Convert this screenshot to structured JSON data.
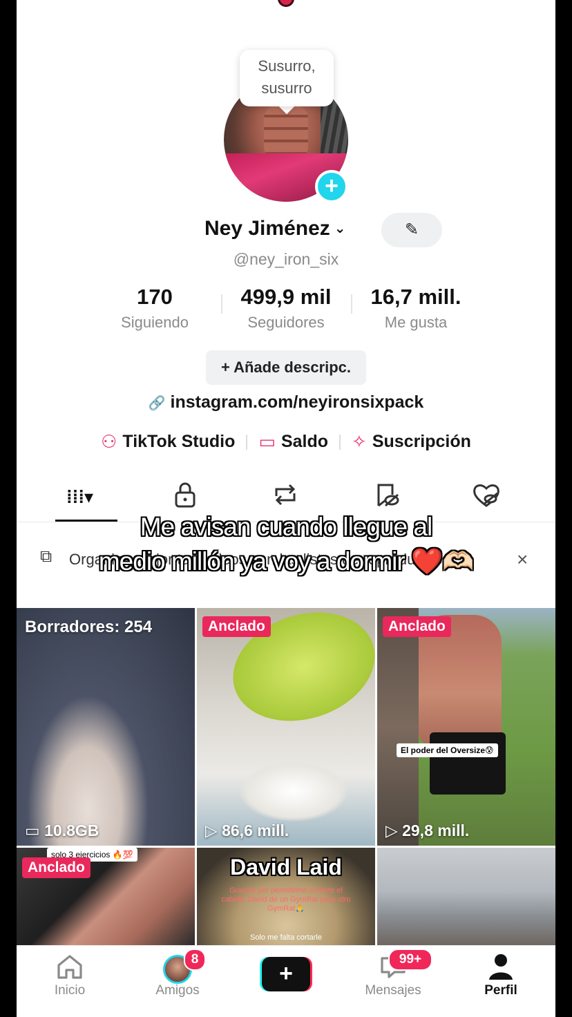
{
  "bubble": {
    "line1": "Susurro,",
    "line2": "susurro"
  },
  "profile": {
    "name": "Ney Jiménez",
    "chevron": "⌄",
    "handle": "@ney_iron_six",
    "edit_icon": "✎",
    "plus_icon": "+"
  },
  "stats": [
    {
      "value": "170",
      "label": "Siguiendo"
    },
    {
      "value": "499,9 mil",
      "label": "Seguidores"
    },
    {
      "value": "16,7 mill.",
      "label": "Me gusta"
    }
  ],
  "description_button": "+ Añade descripc.",
  "link": {
    "icon": "🔗",
    "text": "instagram.com/neyironsixpack"
  },
  "tools": [
    {
      "icon": "person-star-icon",
      "glyph": "⚇",
      "label": "TikTok Studio"
    },
    {
      "icon": "wallet-icon",
      "glyph": "▭",
      "label": "Saldo"
    },
    {
      "icon": "subscription-icon",
      "glyph": "✧",
      "label": "Suscripción"
    }
  ],
  "tabs": [
    {
      "icon": "videos-grid-icon",
      "glyph": "⁞⁞⁞▾"
    },
    {
      "icon": "lock-icon",
      "glyph": "🔒︎"
    },
    {
      "icon": "repost-icon",
      "glyph": "⇅"
    },
    {
      "icon": "favorites-hidden-icon",
      "glyph": "⌧"
    },
    {
      "icon": "liked-hidden-icon",
      "glyph": "♡"
    }
  ],
  "banner": {
    "text": "Organiza mejor tus vídeos con las listas de reproducción",
    "close": "×",
    "icon": "⧉"
  },
  "caption": {
    "line1": "Me avisan cuando llegue al",
    "line2": "medio millón ya voy a dormir ❤️🫶🏻"
  },
  "grid": [
    {
      "badge": "Borradores: 254",
      "stat_icon": "▭",
      "stat": "10.8GB"
    },
    {
      "badge": "Anclado",
      "stat_icon": "▷",
      "stat": "86,6 mill."
    },
    {
      "badge": "Anclado",
      "stat_icon": "▷",
      "stat": "29,8 mill.",
      "overlay": "El poder del Oversize😰"
    },
    {
      "badge": "Anclado",
      "overlay": "solo 3 ejercicios 🔥💯"
    },
    {
      "title": "David Laid",
      "overlay": "Gracias por permitirme cortarte el cabello David de un GymRat para otro GymRat🙏",
      "overlay2": "Solo me falta cortarle"
    },
    {}
  ],
  "nav": [
    {
      "icon": "home-icon",
      "glyph": "⌂",
      "label": "Inicio"
    },
    {
      "icon": "friends-icon",
      "label": "Amigos",
      "badge": "8"
    },
    {
      "icon": "create-icon",
      "glyph": "+"
    },
    {
      "icon": "inbox-icon",
      "glyph": "💬︎",
      "label": "Mensajes",
      "badge": "99+"
    },
    {
      "icon": "profile-icon",
      "glyph": "👤︎",
      "label": "Perfil"
    }
  ]
}
